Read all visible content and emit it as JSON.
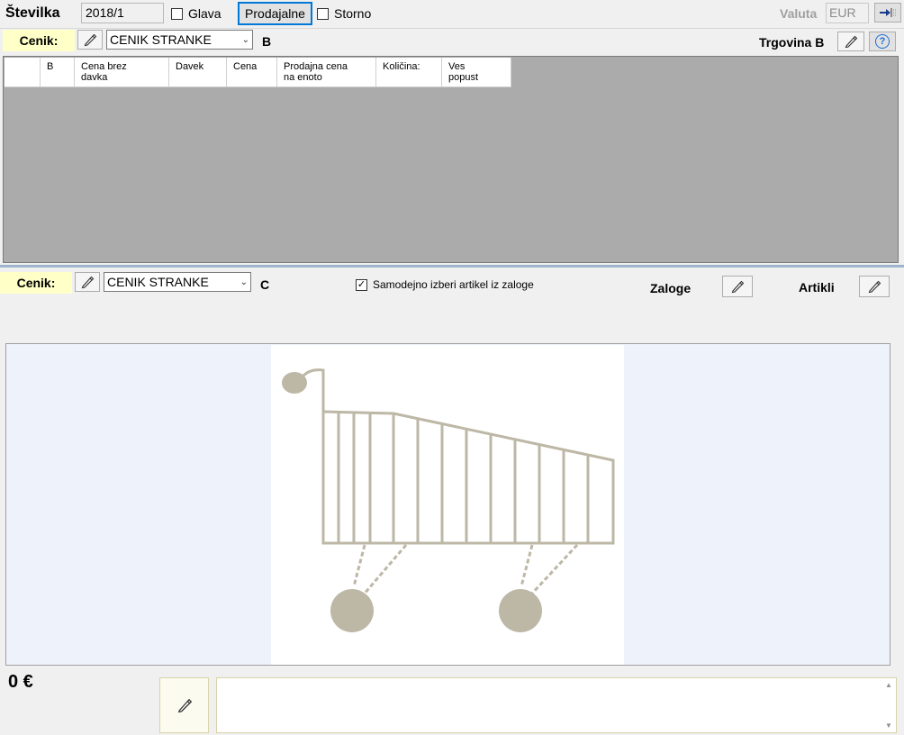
{
  "header": {
    "stevilka_label": "Številka",
    "stevilka_value": "2018/1",
    "glava_label": "Glava",
    "glava_checked": false,
    "prodajalne_label": "Prodajalne",
    "storno_label": "Storno",
    "storno_checked": false,
    "valuta_label": "Valuta",
    "valuta_value": "EUR"
  },
  "section_b": {
    "cenik_label": "Cenik:",
    "cenik_value": "CENIK STRANKE",
    "section_letter": "B",
    "trgovina_label": "Trgovina B",
    "help_symbol": "?",
    "columns": [
      {
        "line1": "",
        "line2": ""
      },
      {
        "line1": "B",
        "line2": ""
      },
      {
        "line1": "Cena brez",
        "line2": "davka"
      },
      {
        "line1": "Davek",
        "line2": ""
      },
      {
        "line1": "Cena",
        "line2": ""
      },
      {
        "line1": "Prodajna cena",
        "line2": "na enoto"
      },
      {
        "line1": "Količina:",
        "line2": ""
      },
      {
        "line1": "Ves",
        "line2": "popust"
      }
    ]
  },
  "section_c": {
    "cenik_label": "Cenik:",
    "cenik_value": "CENIK STRANKE",
    "section_letter": "C",
    "auto_select_label": "Samodejno izberi artikel iz zaloge",
    "auto_select_checked": true,
    "zaloge_label": "Zaloge",
    "artikli_label": "Artikli"
  },
  "footer": {
    "total": "0 €"
  },
  "icons": {
    "pencil": "pencil-icon",
    "exit": "exit-arrow-icon",
    "help": "help-icon",
    "cart": "shopping-cart-icon",
    "dropdown": "chevron-down-icon"
  },
  "colors": {
    "cenik_bg": "#ffffc8",
    "focus_border": "#0078d7",
    "grid_bg": "#ababab",
    "image_panel_bg": "#eef2fb",
    "cart_color": "#bdb7a6"
  }
}
